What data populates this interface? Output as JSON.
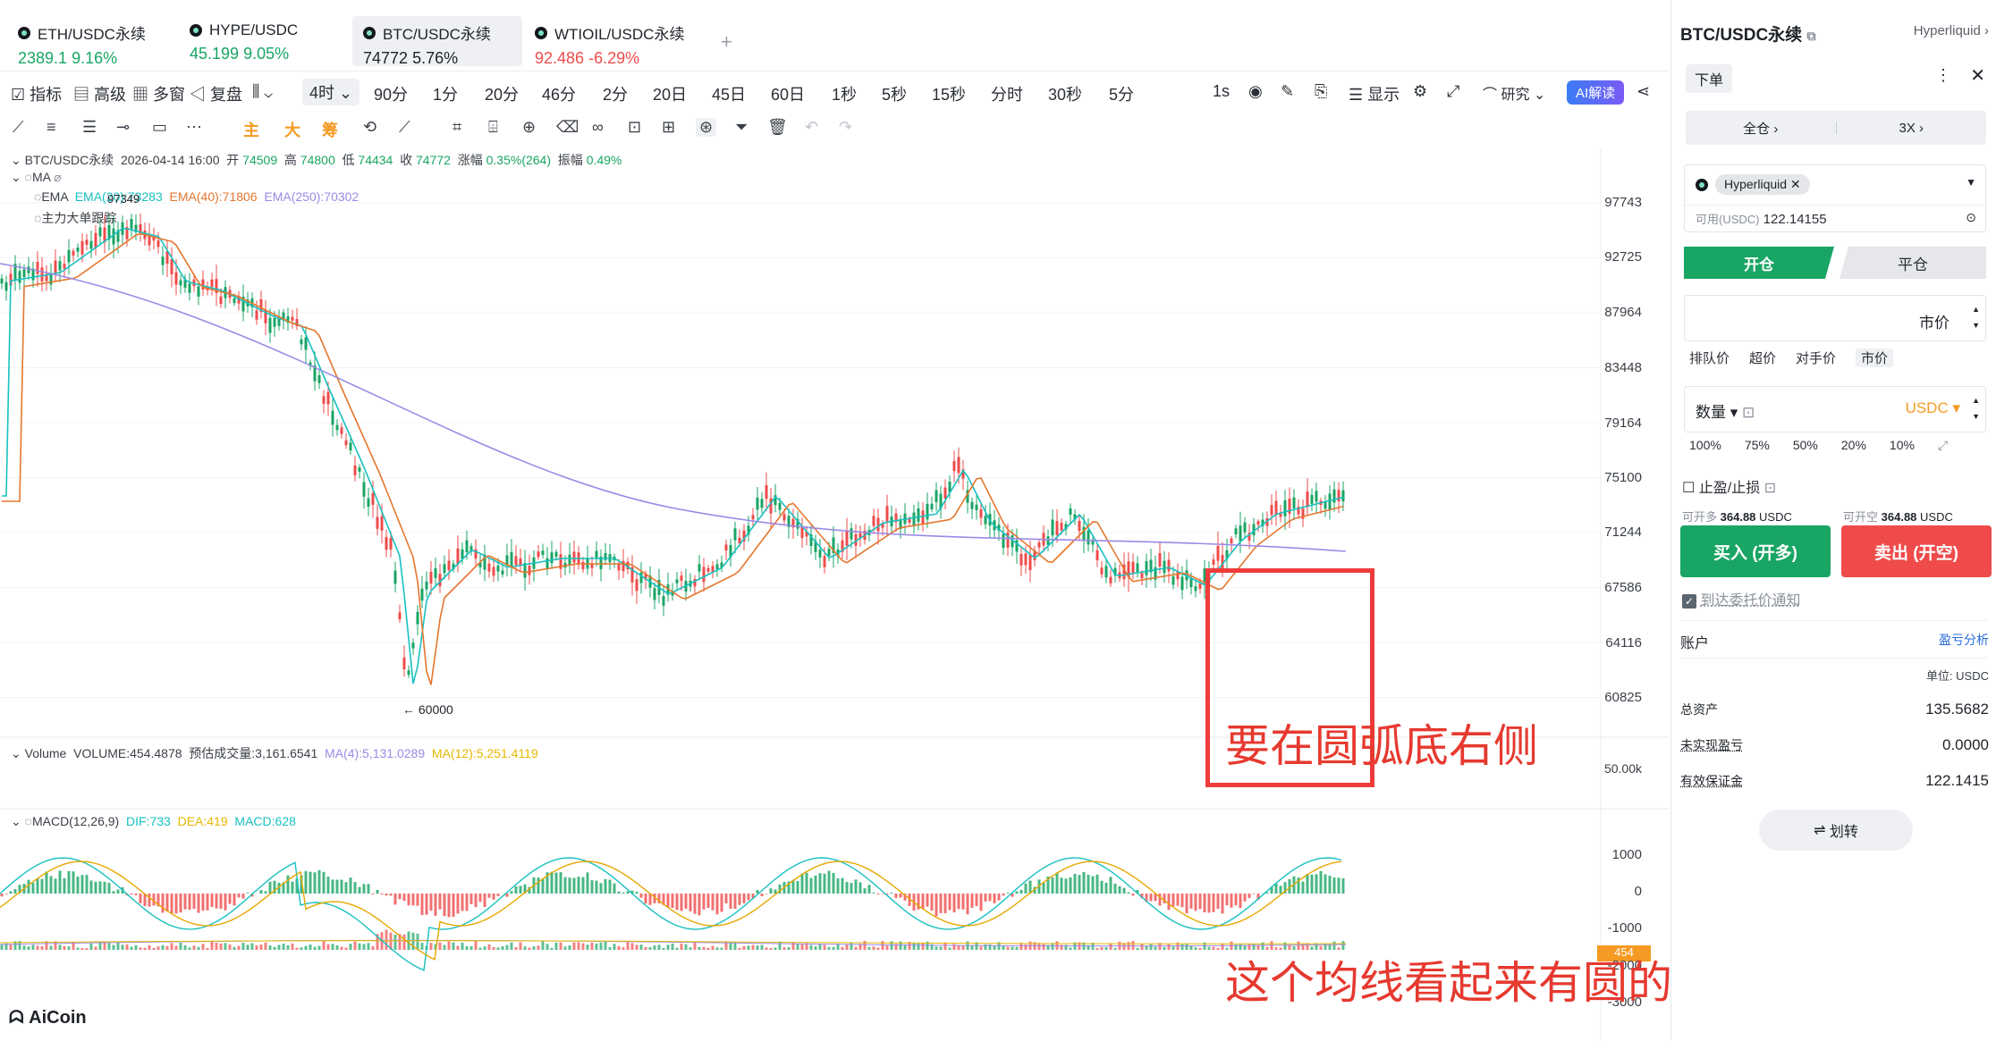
{
  "tabs": [
    {
      "name": "ETH/USDC永续",
      "price": "2389.1",
      "change": "9.16%",
      "dir": "up"
    },
    {
      "name": "HYPE/USDC",
      "price": "45.199",
      "change": "9.05%",
      "dir": "up"
    },
    {
      "name": "BTC/USDC永续",
      "price": "74772",
      "change": "5.76%",
      "dir": "up"
    },
    {
      "name": "WTIOIL/USDC永续",
      "price": "92.486",
      "change": "-6.29%",
      "dir": "down"
    }
  ],
  "add_tab": "+",
  "toolbar": {
    "indicators": "指标",
    "advanced": "高级",
    "multiwin": "多窗",
    "replay": "复盘",
    "intervals": [
      "4时",
      "90分",
      "1分",
      "20分",
      "46分",
      "2分",
      "20日",
      "45日",
      "60日",
      "1秒",
      "5秒",
      "15秒",
      "分时",
      "30秒",
      "5分"
    ],
    "tick": "1s",
    "display": "显示",
    "research": "研究",
    "ai": "AI解读"
  },
  "drawbar": {
    "main": "主",
    "big": "大",
    "chip": "筹"
  },
  "info": {
    "symbol": "BTC/USDC永续",
    "time": "2026-04-14 16:00",
    "open_label": "开",
    "open": "74509",
    "high_label": "高",
    "high": "74800",
    "low_label": "低",
    "low": "74434",
    "close_label": "收",
    "close": "74772",
    "chg_label": "涨幅",
    "chg": "0.35%(264)",
    "amp_label": "振幅",
    "amp": "0.49%",
    "ma": "MA",
    "ema": "EMA",
    "ema20": "EMA(20):73283",
    "ema40": "EMA(40):71806",
    "ema250": "EMA(250):70302",
    "tracker": "主力大单跟踪",
    "volume": "Volume",
    "vol_val": "VOLUME:454.4878",
    "est_vol": "预估成交量:3,161.6541",
    "vol_ma4": "MA(4):5,131.0289",
    "vol_ma12": "MA(12):5,251.4119",
    "macd": "MACD(12,26,9)",
    "dif": "DIF:733",
    "dea": "DEA:419",
    "macd_val": "MACD:628"
  },
  "price_labels": [
    "97743",
    "92725",
    "87964",
    "83448",
    "79164",
    "75100",
    "71244",
    "67586",
    "64116",
    "60825"
  ],
  "volume_labels": [
    "50.00k",
    "454"
  ],
  "macd_labels": [
    "1000",
    "0",
    "-1000",
    "-2000",
    "-3000"
  ],
  "peak_label": "97349",
  "low_label": "← 60000",
  "annotations": {
    "a1": "要在圆弧底右侧",
    "a2": "这个均线看起来有圆的弧度"
  },
  "logo": "AiCoin",
  "panel": {
    "title": "BTC/USDC永续",
    "exchange": "Hyperliquid",
    "order_tab": "下单",
    "margin_mode": "全仓",
    "leverage": "3X",
    "account_chip": "Hyperliquid",
    "available_label": "可用(USDC)",
    "available": "122.14155",
    "open": "开仓",
    "close": "平仓",
    "market": "市价",
    "price_types": [
      "排队价",
      "超价",
      "对手价",
      "市价"
    ],
    "qty": "数量",
    "unit": "USDC",
    "pcts": [
      "100%",
      "75%",
      "50%",
      "20%",
      "10%"
    ],
    "tpsl": "止盈/止损",
    "can_long_label": "可开多",
    "can_long": "364.88",
    "can_short_label": "可开空",
    "can_short": "364.88",
    "buy": "买入 (开多)",
    "sell": "卖出 (开空)",
    "notify": "到达委托价通知",
    "account": "账户",
    "pnl_analysis": "盈亏分析",
    "unit_label": "单位: USDC",
    "total_assets_label": "总资产",
    "total_assets": "135.5682",
    "unrealized_label": "未实现盈亏",
    "unrealized": "0.0000",
    "margin_label": "有效保证金",
    "margin": "122.1415",
    "transfer": "划转"
  },
  "colors": {
    "up": "#19a564",
    "down": "#ef4b4b",
    "ema20": "#19c0c0",
    "ema40": "#e6762e",
    "ema250": "#9b8ae6",
    "accent": "#f59a23"
  }
}
